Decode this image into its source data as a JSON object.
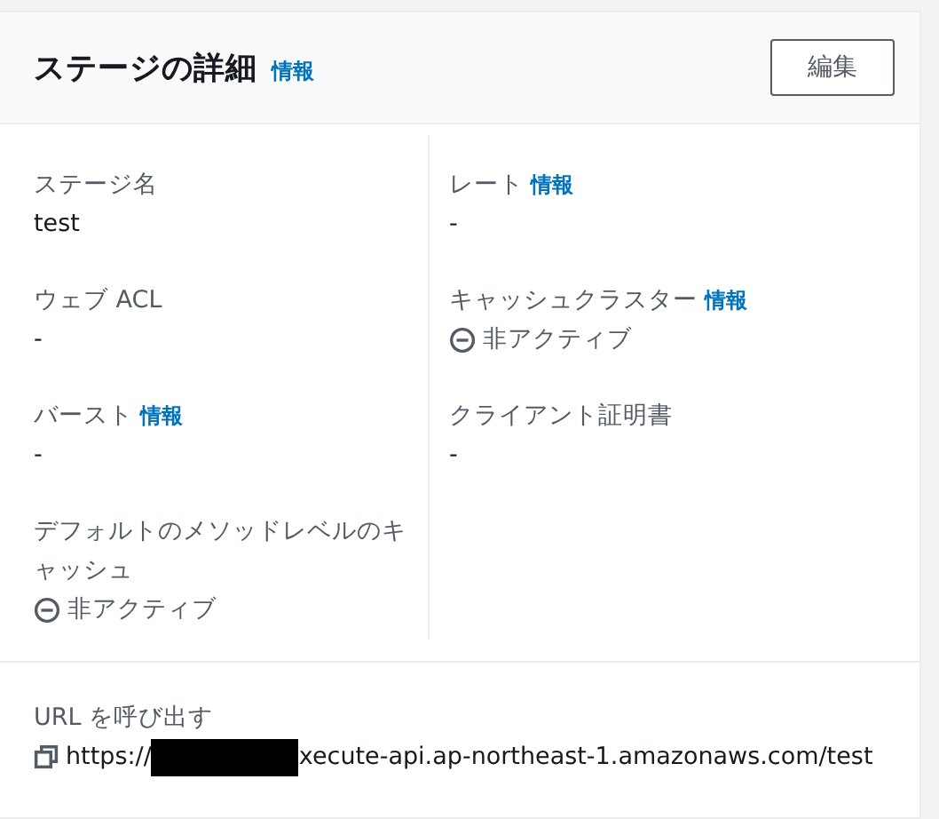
{
  "header": {
    "title": "ステージの詳細",
    "info": "情報",
    "edit_button": "編集"
  },
  "columns": [
    [
      {
        "label": "ステージ名",
        "kind": "text",
        "value": "test"
      },
      {
        "label": "ウェブ ACL",
        "kind": "text",
        "value": "-"
      },
      {
        "label": "バースト",
        "info": "情報",
        "kind": "text",
        "value": "-"
      },
      {
        "label": "デフォルトのメソッドレベルのキャッシュ",
        "kind": "status",
        "value": "非アクティブ"
      }
    ],
    [
      {
        "label": "レート",
        "info": "情報",
        "kind": "text",
        "value": "-"
      },
      {
        "label": "キャッシュクラスター",
        "info": "情報",
        "kind": "status",
        "value": "非アクティブ"
      },
      {
        "label": "クライアント証明書",
        "kind": "text",
        "value": "-"
      }
    ]
  ],
  "invoke_url": {
    "label": "URL を呼び出す",
    "prefix": "https://",
    "redacted": true,
    "suffix": "xecute-api.ap-northeast-1.amazonaws.com/test"
  }
}
